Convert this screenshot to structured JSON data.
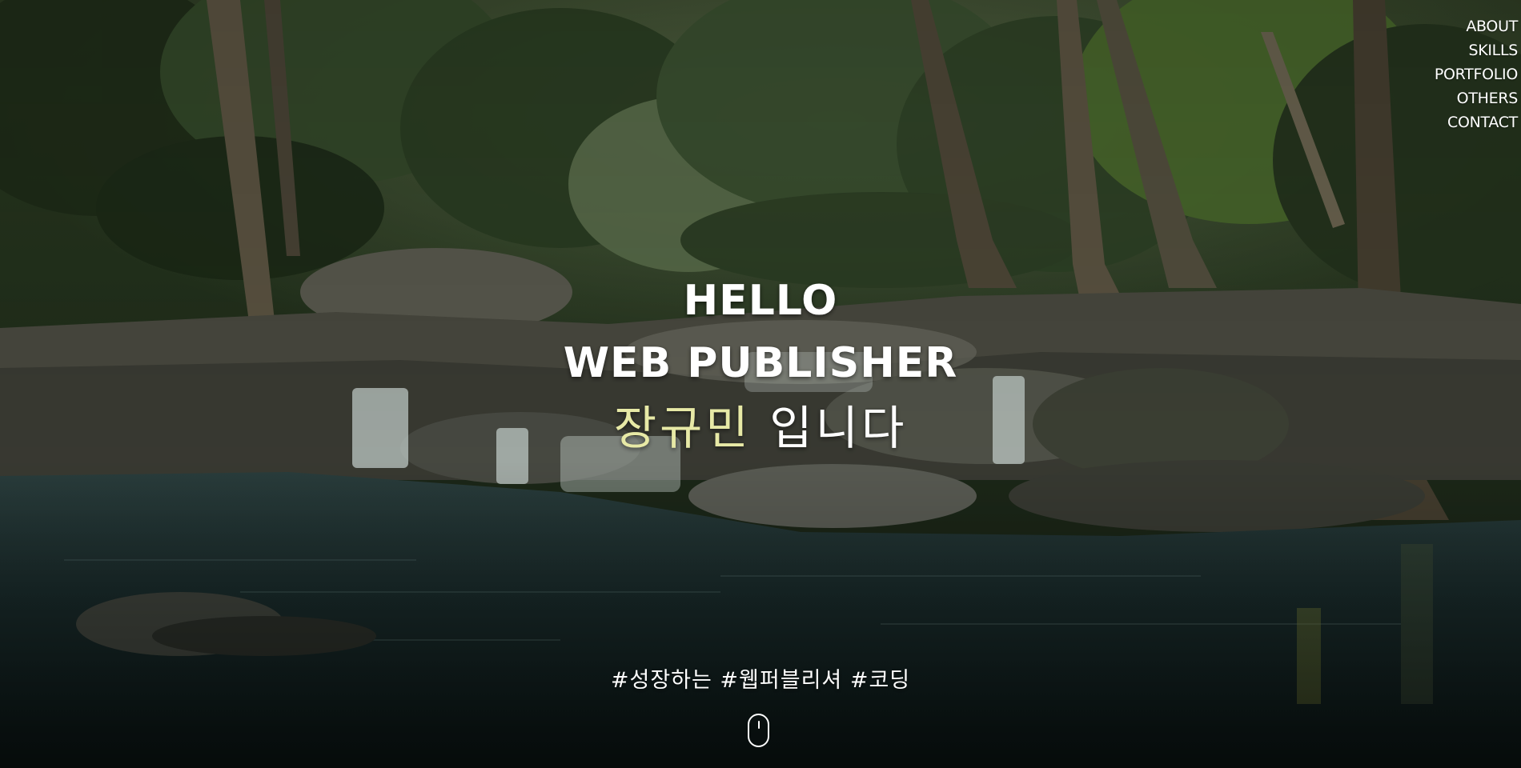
{
  "nav": {
    "items": [
      {
        "label": "ABOUT"
      },
      {
        "label": "SKILLS"
      },
      {
        "label": "PORTFOLIO"
      },
      {
        "label": "OTHERS"
      },
      {
        "label": "CONTACT"
      }
    ]
  },
  "hero": {
    "line1": "HELLO",
    "line2": "WEB PUBLISHER",
    "name": "장규민",
    "suffix": " 입니다"
  },
  "tagline": "#성장하는 #웹퍼블리셔 #코딩",
  "icons": {
    "scroll": "mouse-scroll-icon"
  },
  "colors": {
    "name_accent": "#e7e9a6",
    "text": "#ffffff"
  }
}
